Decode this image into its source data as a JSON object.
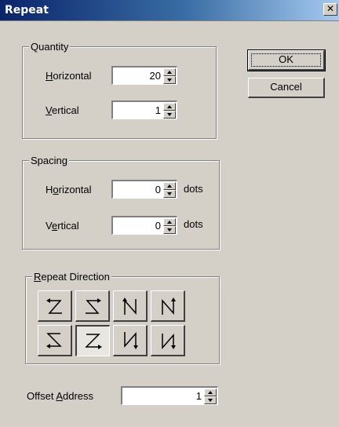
{
  "window": {
    "title": "Repeat",
    "close_glyph": "✕"
  },
  "quantity": {
    "legend": "Quantity",
    "horizontal": {
      "label_prefix": "",
      "label_mnemonic": "H",
      "label_rest": "orizontal",
      "value": "20"
    },
    "vertical": {
      "label_prefix": "",
      "label_mnemonic": "V",
      "label_rest": "ertical",
      "value": "1"
    }
  },
  "spacing": {
    "legend": "Spacing",
    "horizontal": {
      "label_prefix": "H",
      "label_mnemonic": "o",
      "label_rest": "rizontal",
      "value": "0",
      "unit": "dots"
    },
    "vertical": {
      "label_prefix": "V",
      "label_mnemonic": "e",
      "label_rest": "rtical",
      "value": "0",
      "unit": "dots"
    }
  },
  "direction": {
    "legend_mnemonic": "R",
    "legend_rest": "epeat Direction",
    "selected": "bottom-left-to-right-z",
    "options": [
      "top-right-to-left-z",
      "top-left-to-right-z-reverse",
      "bottom-up-n-left",
      "bottom-up-n-right",
      "bottom-right-to-left-s",
      "bottom-left-to-right-z",
      "top-down-n-left",
      "top-down-n-right"
    ]
  },
  "offset": {
    "label_prefix": "Offset ",
    "label_mnemonic": "A",
    "label_rest": "ddress",
    "value": "1"
  },
  "buttons": {
    "ok": "OK",
    "cancel": "Cancel"
  },
  "colors": {
    "title_start": "#0a246a",
    "title_end": "#a6caf0",
    "face": "#d4d0c8"
  }
}
